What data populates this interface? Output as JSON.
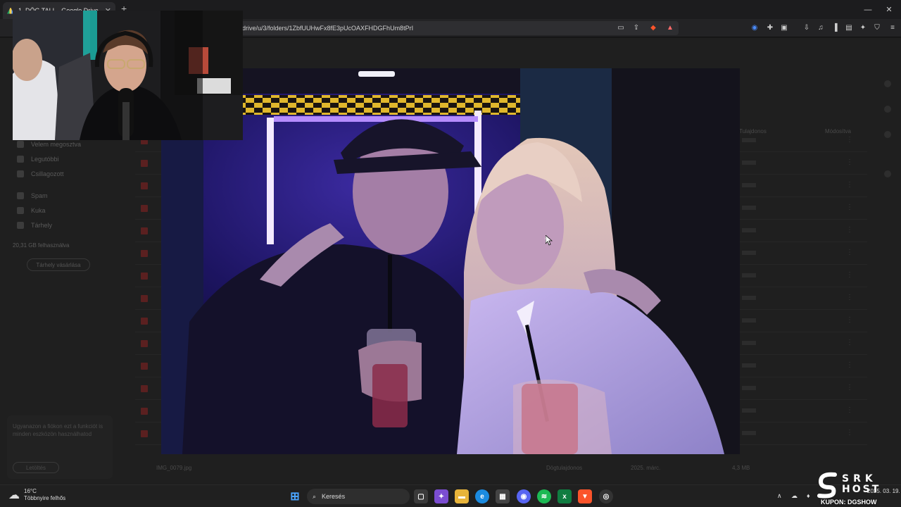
{
  "browser": {
    "tab_title": "1. DÖG TALI – Google Drive",
    "new_tab_glyph": "+",
    "close_glyph": "✕",
    "url": "drive/u/3/folders/1ZbfUUHwFx8fE3pUcOAXFHDGFhUm8tPrI",
    "window_controls": [
      "—",
      "❐",
      "✕"
    ]
  },
  "drive": {
    "sidebar_items": [
      "Velem megosztva",
      "Legutóbbi",
      "Csillagozott",
      "Spam",
      "Kuka",
      "Tárhely"
    ],
    "storage_text": "20,31 GB felhasználva",
    "storage_button": "Tárhely vásárlása",
    "promo_text": "Ugyanazon a fiókon ezt a funkciót is minden eszközön használhatod",
    "promo_button": "Letöltés",
    "header_owner": "Tulajdonos",
    "header_modified": "Módosítva",
    "last_file": "IMG_0079.jpg",
    "last_owner": "Dögtulajdonos",
    "last_date": "2025. márc.",
    "last_size": "4,3 MB"
  },
  "taskbar": {
    "weather_temp": "16°C",
    "weather_desc": "Több­nyire felhős",
    "search_label": "Keresés",
    "tray_date": "2025. 03. 19."
  },
  "overlay": {
    "brand_line1": "SRK",
    "brand_line2": "HOST",
    "coupon": "KUPON: DGSHOW"
  },
  "colors": {
    "accent_blue": "#4a8cff",
    "brave_orange": "#fb542b",
    "spotify_green": "#1db954"
  }
}
